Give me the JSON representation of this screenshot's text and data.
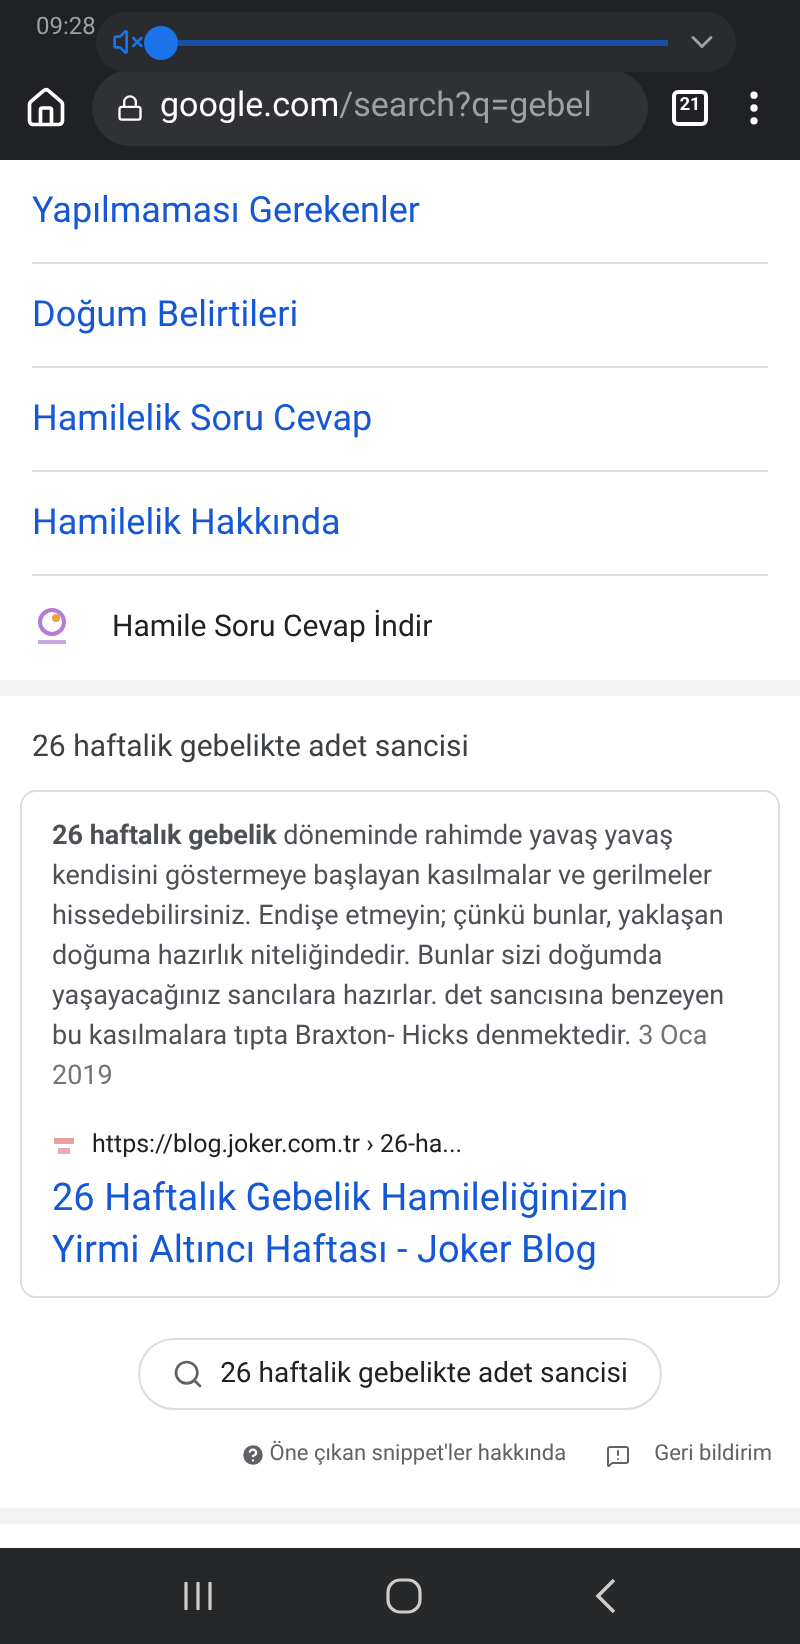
{
  "status_bar": {
    "time": "09:28"
  },
  "volume": {
    "muted": true,
    "level": 0.0
  },
  "browser": {
    "url_host": "google.com",
    "url_path": "/search?q=gebel",
    "tab_count": "21"
  },
  "related_links": [
    {
      "label": "Yapılmaması Gerekenler"
    },
    {
      "label": "Doğum Belirtileri"
    },
    {
      "label": "Hamilelik Soru Cevap"
    },
    {
      "label": "Hamilelik Hakkında"
    }
  ],
  "app_row": {
    "label": "Hamile Soru Cevap İndir"
  },
  "snippet": {
    "heading": "26 haftalik gebelikte adet sancisi",
    "text": "**26 haftalık gebelik** döneminde rahimde yavaş yavaş kendisini göstermeye başlayan kasılmalar ve gerilmeler hissedebilirsiniz. Endişe etmeyin; çünkü bunlar, yaklaşan doğuma hazırlık niteliğindedir. Bunlar sizi doğumda yaşayacağınız sancılara hazırlar. det sancısına benzeyen bu kasılmalara tıpta Braxton- Hicks denmektedir.",
    "date": "3 Oca 2019",
    "source_url": "https://blog.joker.com.tr › 26-ha...",
    "title": "26 Haftalık Gebelik Hamileliğinizin Yirmi Altıncı Haftası - Joker Blog",
    "search_chip": "26 haftalik gebelikte adet sancisi",
    "about": "Öne çıkan snippet'ler hakkında",
    "feedback": "Geri bildirim"
  }
}
